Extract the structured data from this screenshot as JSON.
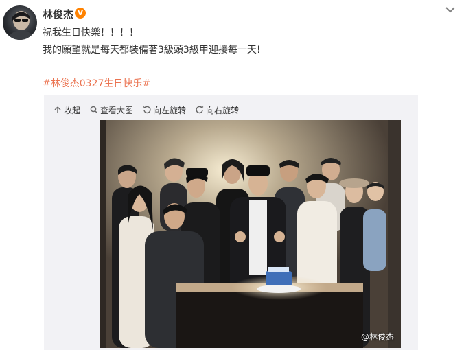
{
  "post": {
    "username": "林俊杰",
    "verified_badge": "V",
    "lines": [
      "祝我生日快樂！！！！",
      "我的願望就是每天都裝備著3級頭3級甲迎接每一天!"
    ],
    "hashtag": "#林俊杰0327生日快乐#"
  },
  "media_toolbar": {
    "collapse": "收起",
    "view_large": "查看大图",
    "rotate_left": "向左旋转",
    "rotate_right": "向右旋转"
  },
  "photo": {
    "watermark": "@林俊杰"
  },
  "icons": [
    "avatar",
    "verified-badge-icon",
    "chevron-down-icon",
    "arrow-up-icon",
    "magnifier-icon",
    "rotate-left-icon",
    "rotate-right-icon"
  ],
  "colors": {
    "hashtag": "#eb7350",
    "badge": "#ff8200",
    "panel": "#f2f2f5"
  }
}
